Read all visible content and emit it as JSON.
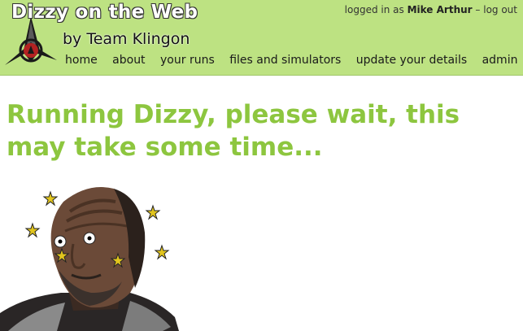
{
  "header": {
    "title": "Dizzy on the Web",
    "subtitle": "by Team Klingon",
    "logo_icon": "klingon-emblem-icon",
    "background": "#bde282"
  },
  "user_bar": {
    "prefix": "logged in as",
    "user_name": "Mike Arthur",
    "separator": "–",
    "logout_label": "log out"
  },
  "nav": {
    "items": [
      "home",
      "about",
      "your runs",
      "files and simulators",
      "update your details",
      "admin"
    ]
  },
  "main": {
    "heading": "Running Dizzy, please wait, this may take some time...",
    "heading_color": "#8dc63f",
    "image_icon": "dizzy-klingon-icon"
  }
}
